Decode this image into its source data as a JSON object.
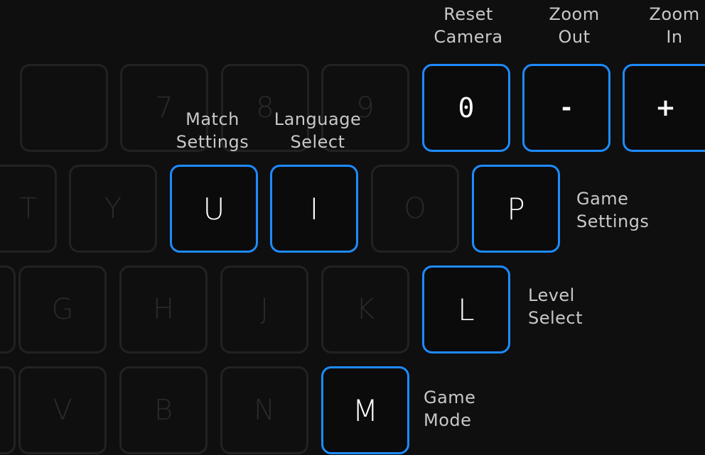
{
  "colors": {
    "background": "#0f0f0f",
    "active_border": "#1e8bff",
    "inactive_border": "#222222",
    "active_text": "#ffffff",
    "inactive_text": "#2a2a2a",
    "label_text": "#c8c8c8"
  },
  "keys": {
    "k7": "7",
    "k8": "8",
    "k9": "9",
    "k0": "0",
    "kminus": "-",
    "kplus": "+",
    "kt": "T",
    "ky": "Y",
    "ku": "U",
    "ki": "I",
    "ko": "O",
    "kp": "P",
    "kg": "G",
    "kh": "H",
    "kj": "J",
    "kk": "K",
    "kl": "L",
    "kv": "V",
    "kb": "B",
    "kn": "N",
    "km": "M"
  },
  "labels": {
    "reset_camera": "Reset\nCamera",
    "zoom_out": "Zoom\nOut",
    "zoom_in": "Zoom\nIn",
    "match_settings": "Match\nSettings",
    "language_select": "Language\nSelect",
    "game_settings": "Game\nSettings",
    "level_select": "Level\nSelect",
    "game_mode": "Game\nMode"
  }
}
